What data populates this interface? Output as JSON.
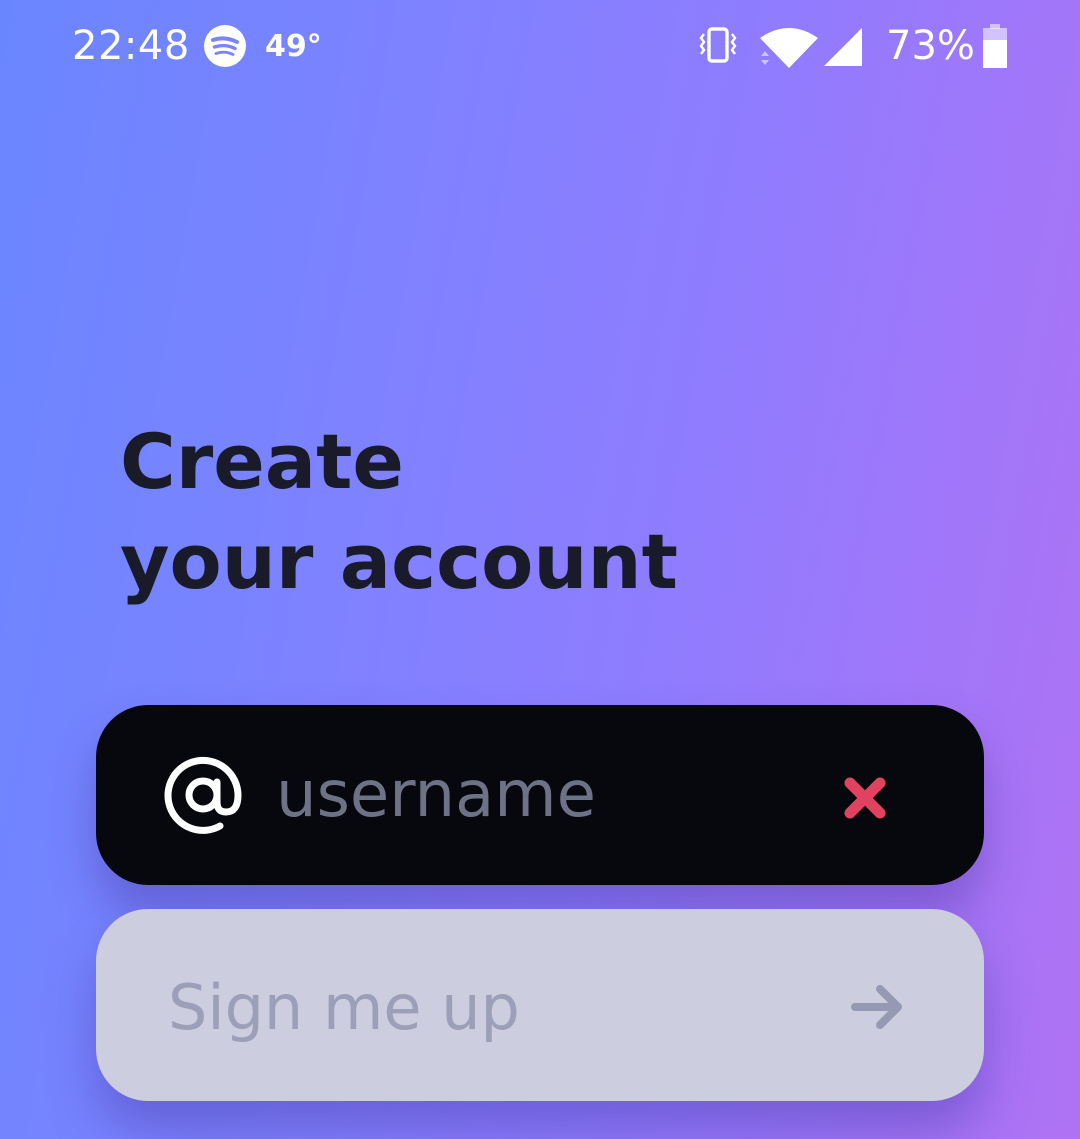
{
  "status_bar": {
    "time": "22:48",
    "temperature": "49°",
    "battery_percent": "73%",
    "icons": [
      "spotify-icon",
      "vibrate-icon",
      "wifi-icon",
      "cell-signal-icon",
      "battery-icon"
    ]
  },
  "screen": {
    "heading_line1": "Create",
    "heading_line2": "your account"
  },
  "username_field": {
    "placeholder": "username",
    "value": "",
    "prefix_icon": "at-icon",
    "clear_icon": "close-icon"
  },
  "signup_button": {
    "label": "Sign me up",
    "icon": "arrow-right-icon",
    "enabled": false
  },
  "colors": {
    "gradient_start": "#6a86ff",
    "gradient_end": "#b072f4",
    "field_background": "#07080d",
    "clear_icon": "#e0435f",
    "button_background": "#cdcde0",
    "button_text": "#9c9fb8",
    "heading_text": "#191a2a"
  }
}
